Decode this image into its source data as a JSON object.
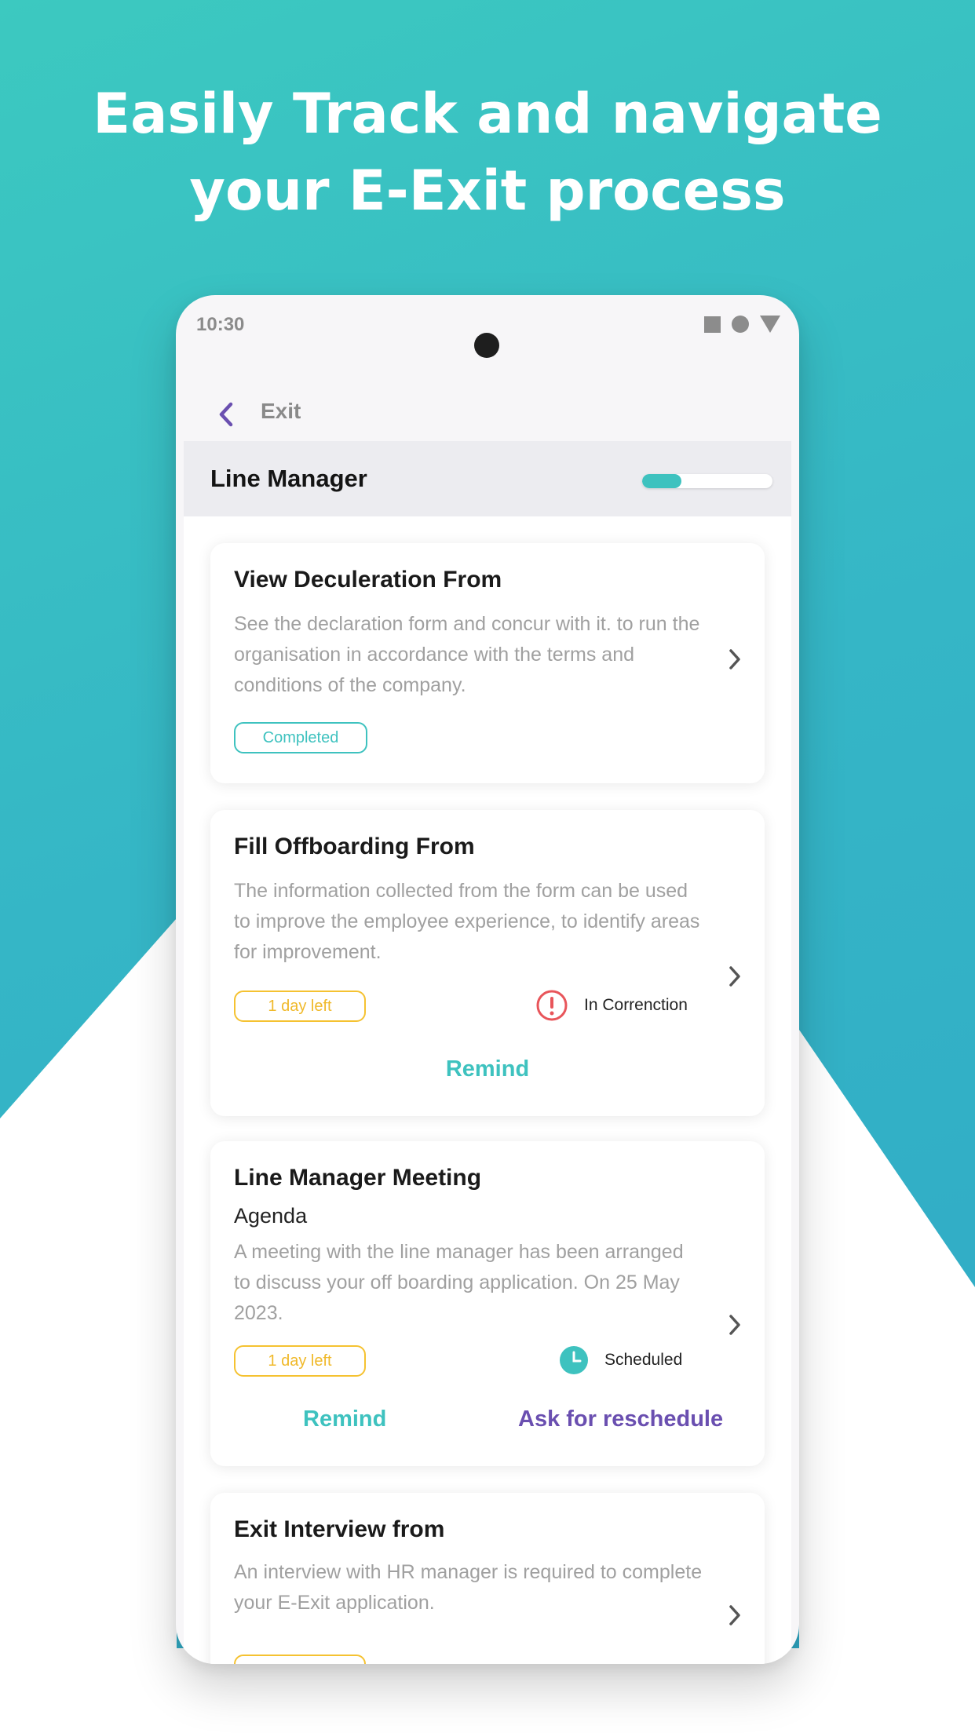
{
  "headline": {
    "line1": "Easily Track and navigate",
    "line2": "your E-Exit process"
  },
  "status_bar": {
    "time": "10:30",
    "icons": [
      "square-icon",
      "circle-icon",
      "triangle-icon"
    ]
  },
  "app_bar": {
    "back_icon": "chevron-left-icon",
    "title": "Exit"
  },
  "section": {
    "title": "Line Manager",
    "progress_percent": 30
  },
  "cards": [
    {
      "title": "View Deculeration From",
      "description": "See the declaration form and concur with it. to run the organisation in accordance with the terms and conditions of the company.",
      "badge": "Completed"
    },
    {
      "title": "Fill Offboarding From",
      "description": "The information collected from the form can be used to improve the employee experience, to identify areas for improvement.",
      "badge": "1 day left",
      "status": "In Correnction",
      "action": "Remind"
    },
    {
      "title": "Line Manager Meeting",
      "subtitle": "Agenda",
      "description": "A meeting with the line manager has been arranged to discuss your off boarding application. On 25 May 2023.",
      "badge": "1 day left",
      "status": "Scheduled",
      "action_primary": "Remind",
      "action_secondary": "Ask for reschedule"
    },
    {
      "title": "Exit Interview from",
      "description": "An interview with HR manager is required to complete your E-Exit application."
    }
  ],
  "colors": {
    "brand_teal": "#3ec2bf",
    "brand_purple": "#6a4fb0",
    "warning_yellow": "#f5c231",
    "alert_red": "#e8555a"
  }
}
